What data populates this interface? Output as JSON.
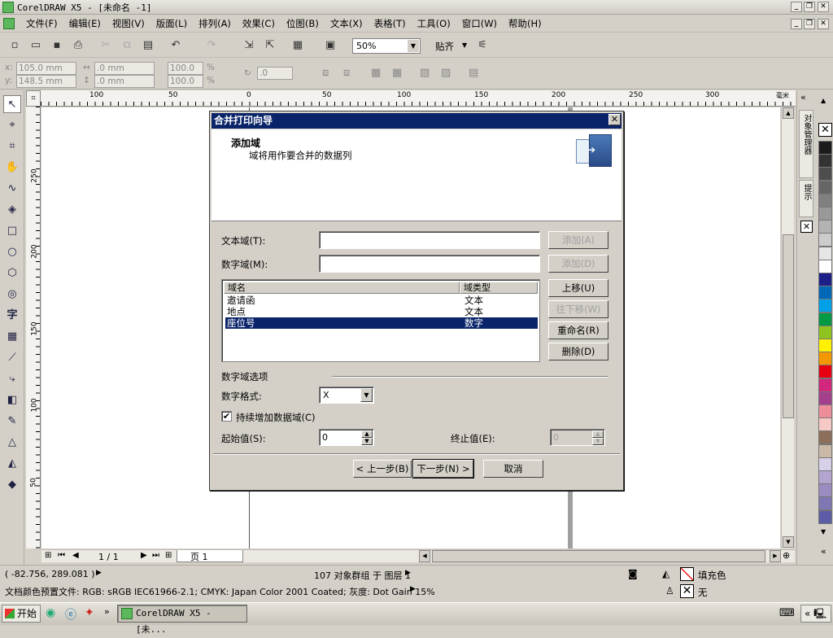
{
  "app": {
    "title": "CorelDRAW X5 - [未命名 -1]"
  },
  "menu": [
    "文件(F)",
    "编辑(E)",
    "视图(V)",
    "版面(L)",
    "排列(A)",
    "效果(C)",
    "位图(B)",
    "文本(X)",
    "表格(T)",
    "工具(O)",
    "窗口(W)",
    "帮助(H)"
  ],
  "toolbar": {
    "zoom": "50%",
    "snap": "贴齐"
  },
  "propbar": {
    "x_label": "x:",
    "x_value": "105.0 mm",
    "y_label": "y:",
    "y_value": "148.5 mm",
    "w_value": ".0 mm",
    "h_value": ".0 mm",
    "sx_value": "100.0",
    "sy_value": "100.0",
    "pct": "%",
    "rot_value": ".0"
  },
  "ruler": {
    "h_labels": [
      "100",
      "50",
      "0",
      "50",
      "100",
      "150",
      "200",
      "250",
      "300"
    ],
    "h_unit": "毫米",
    "v_labels": [
      "250",
      "200",
      "150",
      "100",
      "50"
    ]
  },
  "toolbox": {
    "text_tool": "字"
  },
  "dock": {
    "tab1": "对象管理器",
    "tab2": "提示"
  },
  "page_nav": {
    "count": "1 / 1",
    "tab": "页 1"
  },
  "dialog": {
    "title": "合并打印向导",
    "heading": "添加域",
    "subheading": "域将用作要合并的数据列",
    "text_field_label": "文本域(T):",
    "text_field_value": "",
    "number_field_label": "数字域(M):",
    "number_field_value": "",
    "add_a": "添加(A)",
    "add_d": "添加(D)",
    "list_headers": {
      "name": "域名",
      "type": "域类型"
    },
    "list_rows": [
      {
        "name": "邀请函",
        "type": "文本"
      },
      {
        "name": "地点",
        "type": "文本"
      },
      {
        "name": "座位号",
        "type": "数字"
      }
    ],
    "move_up": "上移(U)",
    "move_down": "往下移(W)",
    "rename": "重命名(R)",
    "delete": "删除(D)",
    "number_options": "数字域选项",
    "number_format_label": "数字格式:",
    "number_format_value": "X",
    "continuous_label": "持续增加数据域(C)",
    "start_label": "起始值(S):",
    "start_value": "0",
    "end_label": "终止值(E):",
    "end_value": "0",
    "back": "< 上一步(B)",
    "next": "下一步(N) >",
    "cancel": "取消"
  },
  "status": {
    "coords": "( -82.756, 289.081 )",
    "objects": "107 对象群组 于 图层 1",
    "fill_label": "填充色",
    "outline_label": "无",
    "profile": "文档颜色预置文件: RGB: sRGB IEC61966-2.1; CMYK: Japan Color 2001 Coated; 灰度: Dot Gain 15%"
  },
  "taskbar": {
    "start": "开始",
    "task": "CorelDRAW X5 - [未..."
  },
  "palette": [
    "#1c1c1c",
    "#333333",
    "#4d4d4d",
    "#666666",
    "#808080",
    "#999999",
    "#b3b3b3",
    "#cccccc",
    "#e6e6e6",
    "#ffffff",
    "#1d2088",
    "#0068b7",
    "#00a0e9",
    "#009944",
    "#8fc31f",
    "#fff100",
    "#f39800",
    "#e60012",
    "#d1277c",
    "#a43f8e",
    "#ee8d9a",
    "#f6c9c5",
    "#8c6f5a",
    "#c9b9a6",
    "#d7d0e8",
    "#b3a5cf",
    "#9a8cc0",
    "#7f77b2",
    "#5c5da6"
  ]
}
